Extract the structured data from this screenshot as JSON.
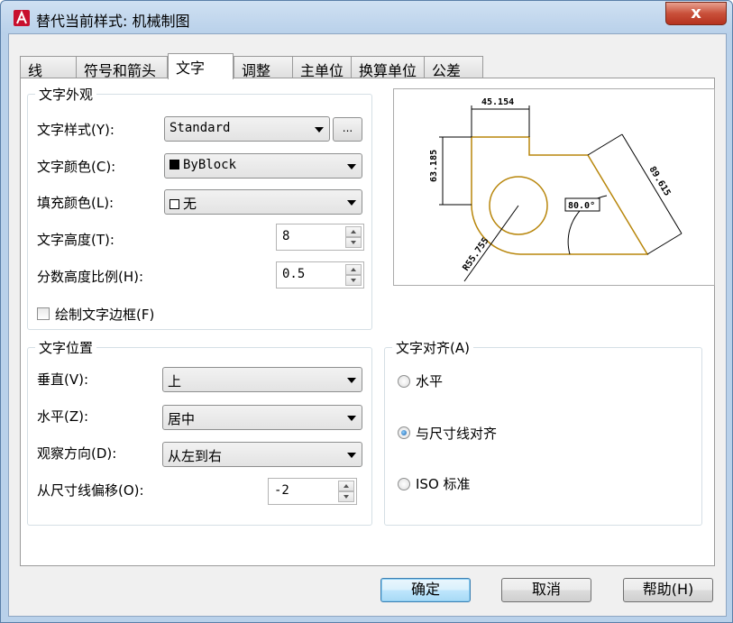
{
  "window": {
    "title": "替代当前样式: 机械制图",
    "close_label": "x"
  },
  "tabs": [
    {
      "label": "线"
    },
    {
      "label": "符号和箭头"
    },
    {
      "label": "文字"
    },
    {
      "label": "调整"
    },
    {
      "label": "主单位"
    },
    {
      "label": "换算单位"
    },
    {
      "label": "公差"
    }
  ],
  "active_tab": "文字",
  "text_appearance": {
    "title": "文字外观",
    "style_label": "文字样式(Y):",
    "style_value": "Standard",
    "style_browse_label": "...",
    "color_label": "文字颜色(C):",
    "color_value": "ByBlock",
    "fill_label": "填充颜色(L):",
    "fill_value": "无",
    "height_label": "文字高度(T):",
    "height_value": "8",
    "fraction_label": "分数高度比例(H):",
    "fraction_value": "0.5",
    "frame_label": "绘制文字边框(F)",
    "frame_checked": false
  },
  "text_placement": {
    "title": "文字位置",
    "vertical_label": "垂直(V):",
    "vertical_value": "上",
    "horizontal_label": "水平(Z):",
    "horizontal_value": "居中",
    "view_label": "观察方向(D):",
    "view_value": "从左到右",
    "offset_label": "从尺寸线偏移(O):",
    "offset_value": "-2"
  },
  "text_alignment": {
    "title": "文字对齐(A)",
    "options": [
      {
        "label": "水平",
        "checked": false
      },
      {
        "label": "与尺寸线对齐",
        "checked": true
      },
      {
        "label": "ISO 标准",
        "checked": false
      }
    ]
  },
  "preview": {
    "dim_top": "45.154",
    "dim_left": "63.185",
    "dim_right": "89.615",
    "dim_angle": "80.0°",
    "dim_radius": "R55.755",
    "geometry_color": "#b8860b"
  },
  "buttons": {
    "ok": "确定",
    "cancel": "取消",
    "help": "帮助(H)"
  }
}
